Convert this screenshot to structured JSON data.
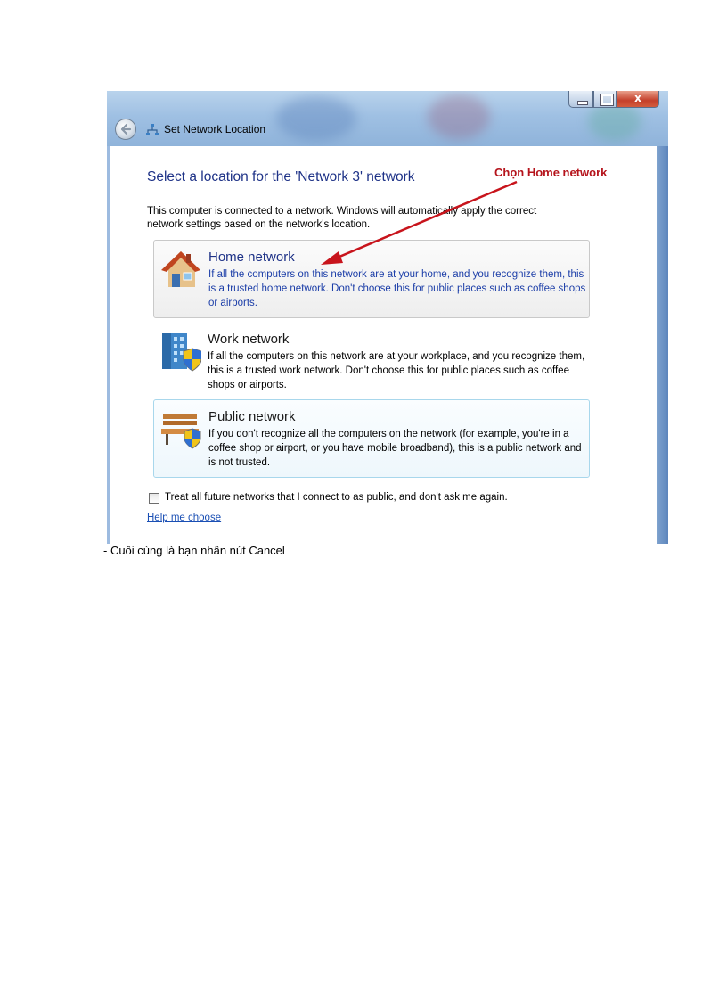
{
  "window": {
    "title": "Set Network Location",
    "controls": {
      "close": "x"
    }
  },
  "dialog": {
    "heading": "Select a location for the 'Network  3' network",
    "intro": "This computer is connected to a network. Windows will automatically apply the correct network settings based on the network's location.",
    "options": [
      {
        "title": "Home network",
        "description": "If all the computers on this network are at your home, and you recognize them, this is a trusted home network.  Don't choose this for public places such as coffee shops or airports.",
        "icon": "house-icon"
      },
      {
        "title": "Work network",
        "description": "If all the computers on this network are at your workplace, and you recognize them, this is a trusted work network.  Don't choose this for public places such as coffee shops or airports.",
        "icon": "office-building-icon"
      },
      {
        "title": "Public network",
        "description": "If you don't recognize all the computers on the network (for example, you're in a coffee shop or airport, or you have mobile broadband), this is a public network and is not trusted.",
        "icon": "park-bench-icon"
      }
    ],
    "checkbox_label": "Treat all future networks that I connect to as public, and don't ask me again.",
    "help_link": "Help me choose"
  },
  "annotation": {
    "text": "Chọn Home network",
    "color": "#b5141c"
  },
  "caption": "- Cuối cùng là bạn nhấn nút Cancel"
}
